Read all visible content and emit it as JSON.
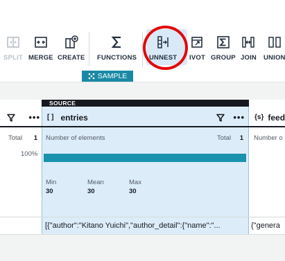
{
  "toolbar": {
    "tools": [
      {
        "id": "split",
        "label": "SPLIT",
        "icon": "split-icon",
        "disabled": true
      },
      {
        "id": "merge",
        "label": "MERGE",
        "icon": "merge-icon",
        "disabled": false
      },
      {
        "id": "create",
        "label": "CREATE",
        "icon": "create-icon",
        "disabled": false
      },
      {
        "id": "functions",
        "label": "FUNCTIONS",
        "icon": "sigma-icon",
        "disabled": false
      },
      {
        "id": "unnest",
        "label": "UNNEST",
        "icon": "unnest-icon",
        "disabled": false,
        "highlighted": true
      },
      {
        "id": "pivot",
        "label": "IVOT",
        "icon": "pivot-icon",
        "disabled": false
      },
      {
        "id": "group",
        "label": "GROUP",
        "icon": "group-icon",
        "disabled": false
      },
      {
        "id": "join",
        "label": "JOIN",
        "icon": "join-icon",
        "disabled": false
      },
      {
        "id": "union",
        "label": "UNION",
        "icon": "union-icon",
        "disabled": false
      }
    ],
    "sample_label": "SAMPLE"
  },
  "left_column": {
    "total_label": "Total",
    "total_value": "1",
    "percent": "100%"
  },
  "main_column": {
    "source_tag": "SOURCE",
    "type_icon": "[ ]",
    "name": "entries",
    "stat_label": "Number of elements",
    "total_label": "Total",
    "total_value": "1",
    "bar_fill": 1.0,
    "min_label": "Min",
    "min_value": "30",
    "mean_label": "Mean",
    "mean_value": "30",
    "max_label": "Max",
    "max_value": "30",
    "cell_value": "[{\"author\":\"Kitano Yuichi\",\"author_detail\":{\"name\":\"..."
  },
  "right_column": {
    "type_icon": "{s}",
    "name": "feed",
    "stat_label": "Number o",
    "cell_value": "{\"genera"
  },
  "colors": {
    "accent": "#1a91ad",
    "selected_column": "#dcedf9",
    "highlight_circle": "#e10a0a"
  }
}
